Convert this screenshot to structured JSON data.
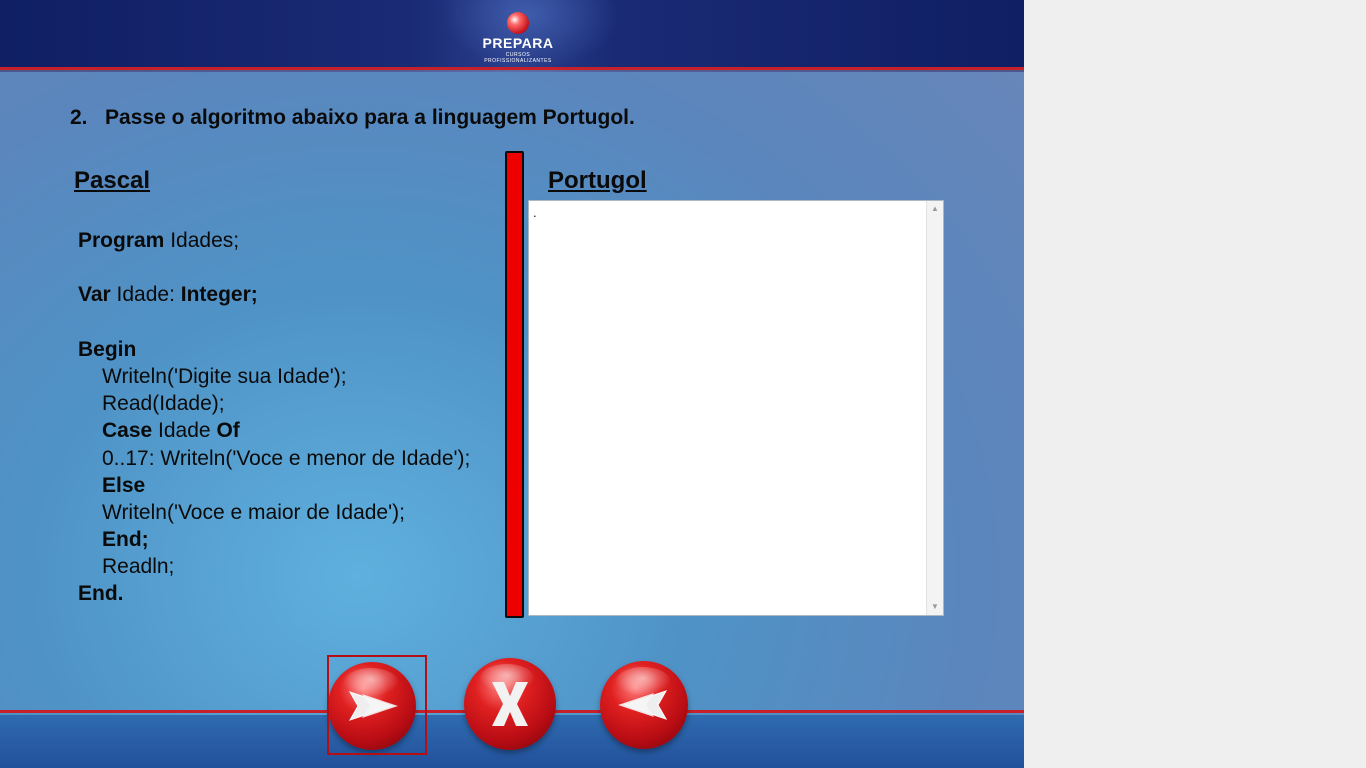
{
  "header": {
    "logo_name": "PREPARA",
    "logo_tagline": "CURSOS PROFISSIONALIZANTES"
  },
  "question": {
    "number": "2.",
    "text": "Passe o algoritmo abaixo para a linguagem Portugol."
  },
  "pascal": {
    "title": "Pascal",
    "lines": {
      "program_kw": "Program",
      "program_rest": " Idades;",
      "var_kw": "Var",
      "var_mid": " Idade: ",
      "var_type": "Integer;",
      "begin_kw": "Begin",
      "line_writeln_prompt": "Writeln('Digite sua Idade');",
      "line_read": "Read(Idade);",
      "case_kw": "Case",
      "case_mid": " Idade ",
      "of_kw": "Of",
      "line_case_option": "0..17: Writeln('Voce e menor de Idade');",
      "else_kw": "Else",
      "line_writeln_else": "Writeln('Voce e maior de Idade');",
      "end_case_kw": "End;",
      "line_readln": "Readln;",
      "end_program_kw": "End."
    }
  },
  "portugol": {
    "title": "Portugol",
    "textarea_value": "."
  },
  "colors": {
    "divider": "#ee0000",
    "header_band": "#101f63",
    "accent_red": "#c8202a",
    "button_red": "#e02020"
  },
  "navigation": {
    "next_icon": "forward-arrow-icon",
    "close_icon": "close-x-icon",
    "back_icon": "back-arrow-icon"
  }
}
